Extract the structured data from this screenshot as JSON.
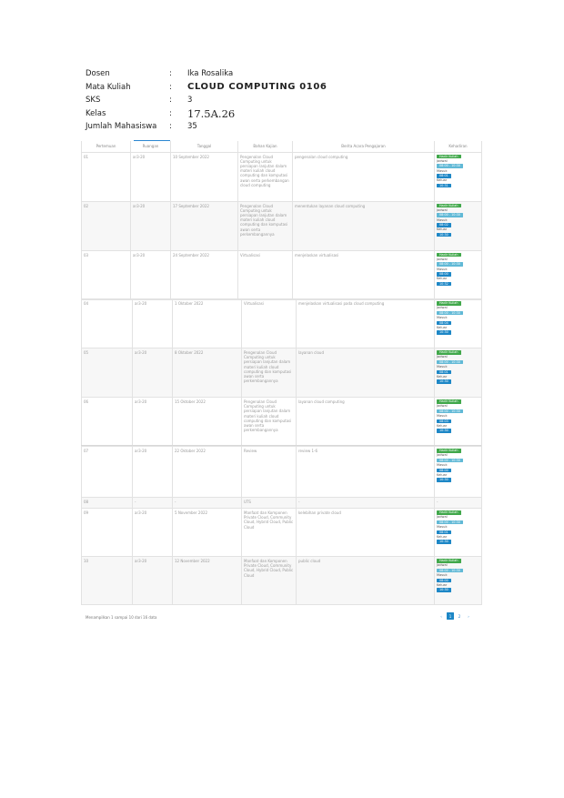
{
  "info": [
    {
      "label": "Dosen",
      "colon": ":",
      "value": "Ika Rosalika"
    },
    {
      "label": "Mata Kuliah",
      "colon": ":",
      "value": "CLOUD COMPUTING 0106"
    },
    {
      "label": "SKS",
      "colon": ":",
      "value": "3"
    },
    {
      "label": "Kelas",
      "colon": ":",
      "value": "17.5A.26"
    },
    {
      "label": "Jumlah Mahasiswa",
      "colon": ":",
      "value": "35"
    }
  ],
  "table": {
    "headers": [
      "Pertemuan",
      "Ruangan",
      "Tanggal",
      "Bahan Kajian",
      "Berita Acara Pengajaran",
      "Kehadiran"
    ]
  },
  "rows": [
    {
      "no": "01",
      "room": "ar3-20",
      "date": "10 September 2022",
      "topic": "Pengenalan Cloud Computing untuk persiapan lanjutan dalam materi kuliah cloud computing dan komputasi awan serta perkembangan cloud computing",
      "report": "pengenalan cloud computing",
      "status": "Hadir Kuliah",
      "label1": "Jadwal",
      "val1": "08:00 - 10:30",
      "label2": "Masuk",
      "val2": "08:01",
      "label3": "Keluar",
      "val3": "10:31"
    },
    {
      "no": "02",
      "room": "ar3-20",
      "date": "17 September 2022",
      "topic": "Pengenalan Cloud Computing untuk persiapan lanjutan dalam materi kuliah cloud computing dan komputasi awan serta perkembangannya",
      "report": "menentukan layanan cloud computing",
      "status": "Hadir Kuliah",
      "label1": "Jadwal",
      "val1": "08:00 - 10:30",
      "label2": "Masuk",
      "val2": "08:02",
      "label3": "Keluar",
      "val3": "10:30"
    },
    {
      "no": "03",
      "room": "ar3-20",
      "date": "24 September 2022",
      "topic": "Virtualisasi",
      "report": "menjelaskan virtualisasi",
      "status": "Hadir Kuliah",
      "label1": "Jadwal",
      "val1": "08:00 - 10:30",
      "label2": "Masuk",
      "val2": "08:00",
      "label3": "Keluar",
      "val3": "10:32"
    },
    {
      "no": "04",
      "room": "ar3-20",
      "date": "1 Oktober 2022",
      "topic": "Virtualisasi",
      "report": "menjelaskan virtualisasi pada cloud computing",
      "status": "Hadir Kuliah",
      "label1": "Jadwal",
      "val1": "08:00 - 10:30",
      "label2": "Masuk",
      "val2": "08:04",
      "label3": "Keluar",
      "val3": "10:30"
    },
    {
      "no": "05",
      "room": "ar3-20",
      "date": "8 Oktober 2022",
      "topic": "Pengenalan Cloud Computing untuk persiapan lanjutan dalam materi kuliah cloud computing dan komputasi awan serta perkembangannya",
      "report": "layanan cloud",
      "status": "Hadir Kuliah",
      "label1": "Jadwal",
      "val1": "08:00 - 10:30",
      "label2": "Masuk",
      "val2": "08:01",
      "label3": "Keluar",
      "val3": "10:30"
    },
    {
      "no": "06",
      "room": "ar3-20",
      "date": "15 Oktober 2022",
      "topic": "Pengenalan Cloud Computing untuk persiapan lanjutan dalam materi kuliah cloud computing dan komputasi awan serta perkembangannya",
      "report": "layanan cloud computing",
      "status": "Hadir Kuliah",
      "label1": "Jadwal",
      "val1": "08:00 - 10:30",
      "label2": "Masuk",
      "val2": "08:03",
      "label3": "Keluar",
      "val3": "10:30"
    },
    {
      "no": "07",
      "room": "ar3-20",
      "date": "22 Oktober 2022",
      "topic": "Review",
      "report": "review 1-6",
      "status": "Hadir Kuliah",
      "label1": "Jadwal",
      "val1": "08:00 - 10:30",
      "label2": "Masuk",
      "val2": "08:00",
      "label3": "Keluar",
      "val3": "10:30"
    },
    {
      "no": "08",
      "room": "-",
      "date": "-",
      "topic": "UTS",
      "report": "-",
      "status": "",
      "label1": "",
      "val1": "",
      "label2": "",
      "val2": "",
      "label3": "",
      "val3": ""
    },
    {
      "no": "09",
      "room": "ar3-20",
      "date": "5 November 2022",
      "topic": "Manfaat dan Komponen Private Cloud, Community Cloud, Hybrid Cloud, Public Cloud",
      "report": "kelebihan private cloud",
      "status": "Hadir Kuliah",
      "label1": "Jadwal",
      "val1": "08:00 - 10:30",
      "label2": "Masuk",
      "val2": "08:01",
      "label3": "Keluar",
      "val3": "10:30"
    },
    {
      "no": "10",
      "room": "ar3-20",
      "date": "12 November 2022",
      "topic": "Manfaat dan Komponen Private Cloud, Community Cloud, Hybrid Cloud, Public Cloud",
      "report": "public cloud",
      "status": "Hadir Kuliah",
      "label1": "Jadwal",
      "val1": "08:00 - 10:30",
      "label2": "Masuk",
      "val2": "08:00",
      "label3": "Keluar",
      "val3": "10:30"
    }
  ],
  "footer": {
    "text": "Menampilkan 1 sampai 10 dari 16 data"
  },
  "pagination": {
    "prev": "‹",
    "current": "1",
    "next_page": "2",
    "next": "›"
  }
}
